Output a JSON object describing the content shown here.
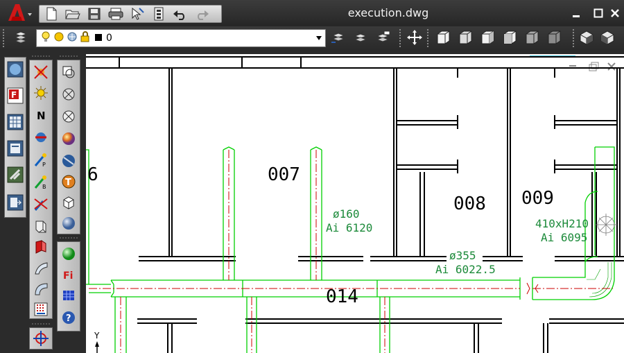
{
  "window": {
    "title": "execution.dwg",
    "controls": {
      "minimize": "minimize-icon",
      "maximize": "maximize-icon",
      "close": "close-icon"
    }
  },
  "quick_access": [
    "new-icon",
    "open-icon",
    "save-icon",
    "plot-icon",
    "cursor-icon",
    "properties-icon",
    "undo-icon",
    "redo-icon"
  ],
  "layer_toolbar": {
    "current_layer": "0",
    "icons": [
      "bulb-icon",
      "sun-icon",
      "freeze-icon",
      "lock-icon",
      "color-swatch-icon"
    ],
    "tools": [
      "layer-manager-icon",
      "layer-previous-icon",
      "make-current-icon",
      "match-layer-icon"
    ]
  },
  "view_toolbar": {
    "icons": [
      "pan-icon",
      "top-view-icon",
      "bottom-view-icon",
      "left-view-icon",
      "right-view-icon",
      "front-view-icon",
      "back-view-icon",
      "iso-view-icon",
      "iso-view2-icon"
    ]
  },
  "left_tools": [
    "globe-icon",
    "f-icon",
    "grid-icon",
    "window-icon",
    "tools-icon",
    "stack-icon"
  ],
  "render_tools": [
    "light-off-icon",
    "sun-icon",
    "north-icon",
    "lens-icon",
    "point-light-icon",
    "spot-light-icon",
    "no-light-icon",
    "surface-icon",
    "solid-icon",
    "curve-icon",
    "arc-icon",
    "pattern-icon",
    "target-icon"
  ],
  "shading_tools": [
    "shape-icon",
    "no-hatch-icon",
    "circle-x-icon",
    "sphere-icon",
    "sphere2-icon",
    "t-icon",
    "cube-icon",
    "ball-icon",
    "green-ball-icon",
    "fi-icon",
    "grid-blue-icon",
    "help-icon"
  ],
  "drawing": {
    "rooms": [
      "6",
      "007",
      "008",
      "009",
      "014"
    ],
    "duct_labels": [
      {
        "line1": "ø160",
        "line2": "Ai 6120"
      },
      {
        "line1": "ø355",
        "line2": "Ai 6022.5"
      },
      {
        "line1": "410xH210",
        "line2": "Ai 6095"
      }
    ],
    "ucs_label": "Y",
    "colors": {
      "walls": "#000000",
      "duct": "#00d000",
      "duct_text": "#1c8a3a",
      "centerline": "#cc0000"
    }
  }
}
